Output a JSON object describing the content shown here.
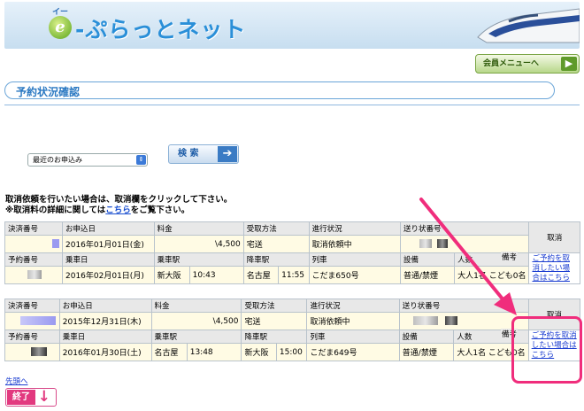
{
  "header": {
    "logo_small": "イー",
    "logo_e": "e",
    "logo_text": "-ぷらっとネット"
  },
  "member_menu": {
    "label": "会員メニューへ",
    "arrow": "▶"
  },
  "page_title": "予約状況確認",
  "filter": {
    "selected": "最近のお申込み",
    "arrow": "⇕"
  },
  "search": {
    "label": "検 索",
    "arrow": "➔"
  },
  "notice": {
    "line1": "取消依頼を行いたい場合は、取消欄をクリックして下さい。",
    "line2_pre": "※取消料の詳細に関しては",
    "line2_link": "こちら",
    "line2_post": "をご覧下さい。"
  },
  "header_labels": {
    "settlement_no": "決済番号",
    "apply_date": "お申込日",
    "fee": "料金",
    "receive_method": "受取方法",
    "progress": "進行状況",
    "tracking_no": "送り状番号",
    "cancel": "取消",
    "reservation_no": "予約番号",
    "board_date": "乗車日",
    "board_station": "乗車駅",
    "alight_station": "降車駅",
    "train": "列車",
    "facility": "設備",
    "people": "人数",
    "remarks": "備考"
  },
  "reservations": [
    {
      "apply_date": "2016年01月01日(金)",
      "fee": "\\4,500",
      "receive_method": "宅送",
      "progress": "取消依頼中",
      "board_date": "2016年02月01日(月)",
      "board_station": "新大阪",
      "depart": "10:43",
      "alight_station": "名古屋",
      "arrive": "11:55",
      "train": "こだま650号",
      "facility": "普通/禁煙",
      "people": "大人1名 こども0名",
      "cancel_label": "ご予約を取消したい場合はこちら"
    },
    {
      "apply_date": "2015年12月31日(木)",
      "fee": "\\4,500",
      "receive_method": "宅送",
      "progress": "取消依頼中",
      "board_date": "2016年01月30日(土)",
      "board_station": "名古屋",
      "depart": "13:48",
      "alight_station": "新大阪",
      "arrive": "15:00",
      "train": "こだま649号",
      "facility": "普通/禁煙",
      "people": "大人1名 こども0名",
      "cancel_label": "ご予約を取消したい場合はこちら"
    }
  ],
  "footer": {
    "back_link": "先頭へ",
    "end_label": "終了",
    "end_arrow": "↓"
  },
  "colors": {
    "accent_blue": "#2a78c2",
    "highlight_pink": "#f02d7c",
    "row_yellow": "#fffbe4"
  }
}
